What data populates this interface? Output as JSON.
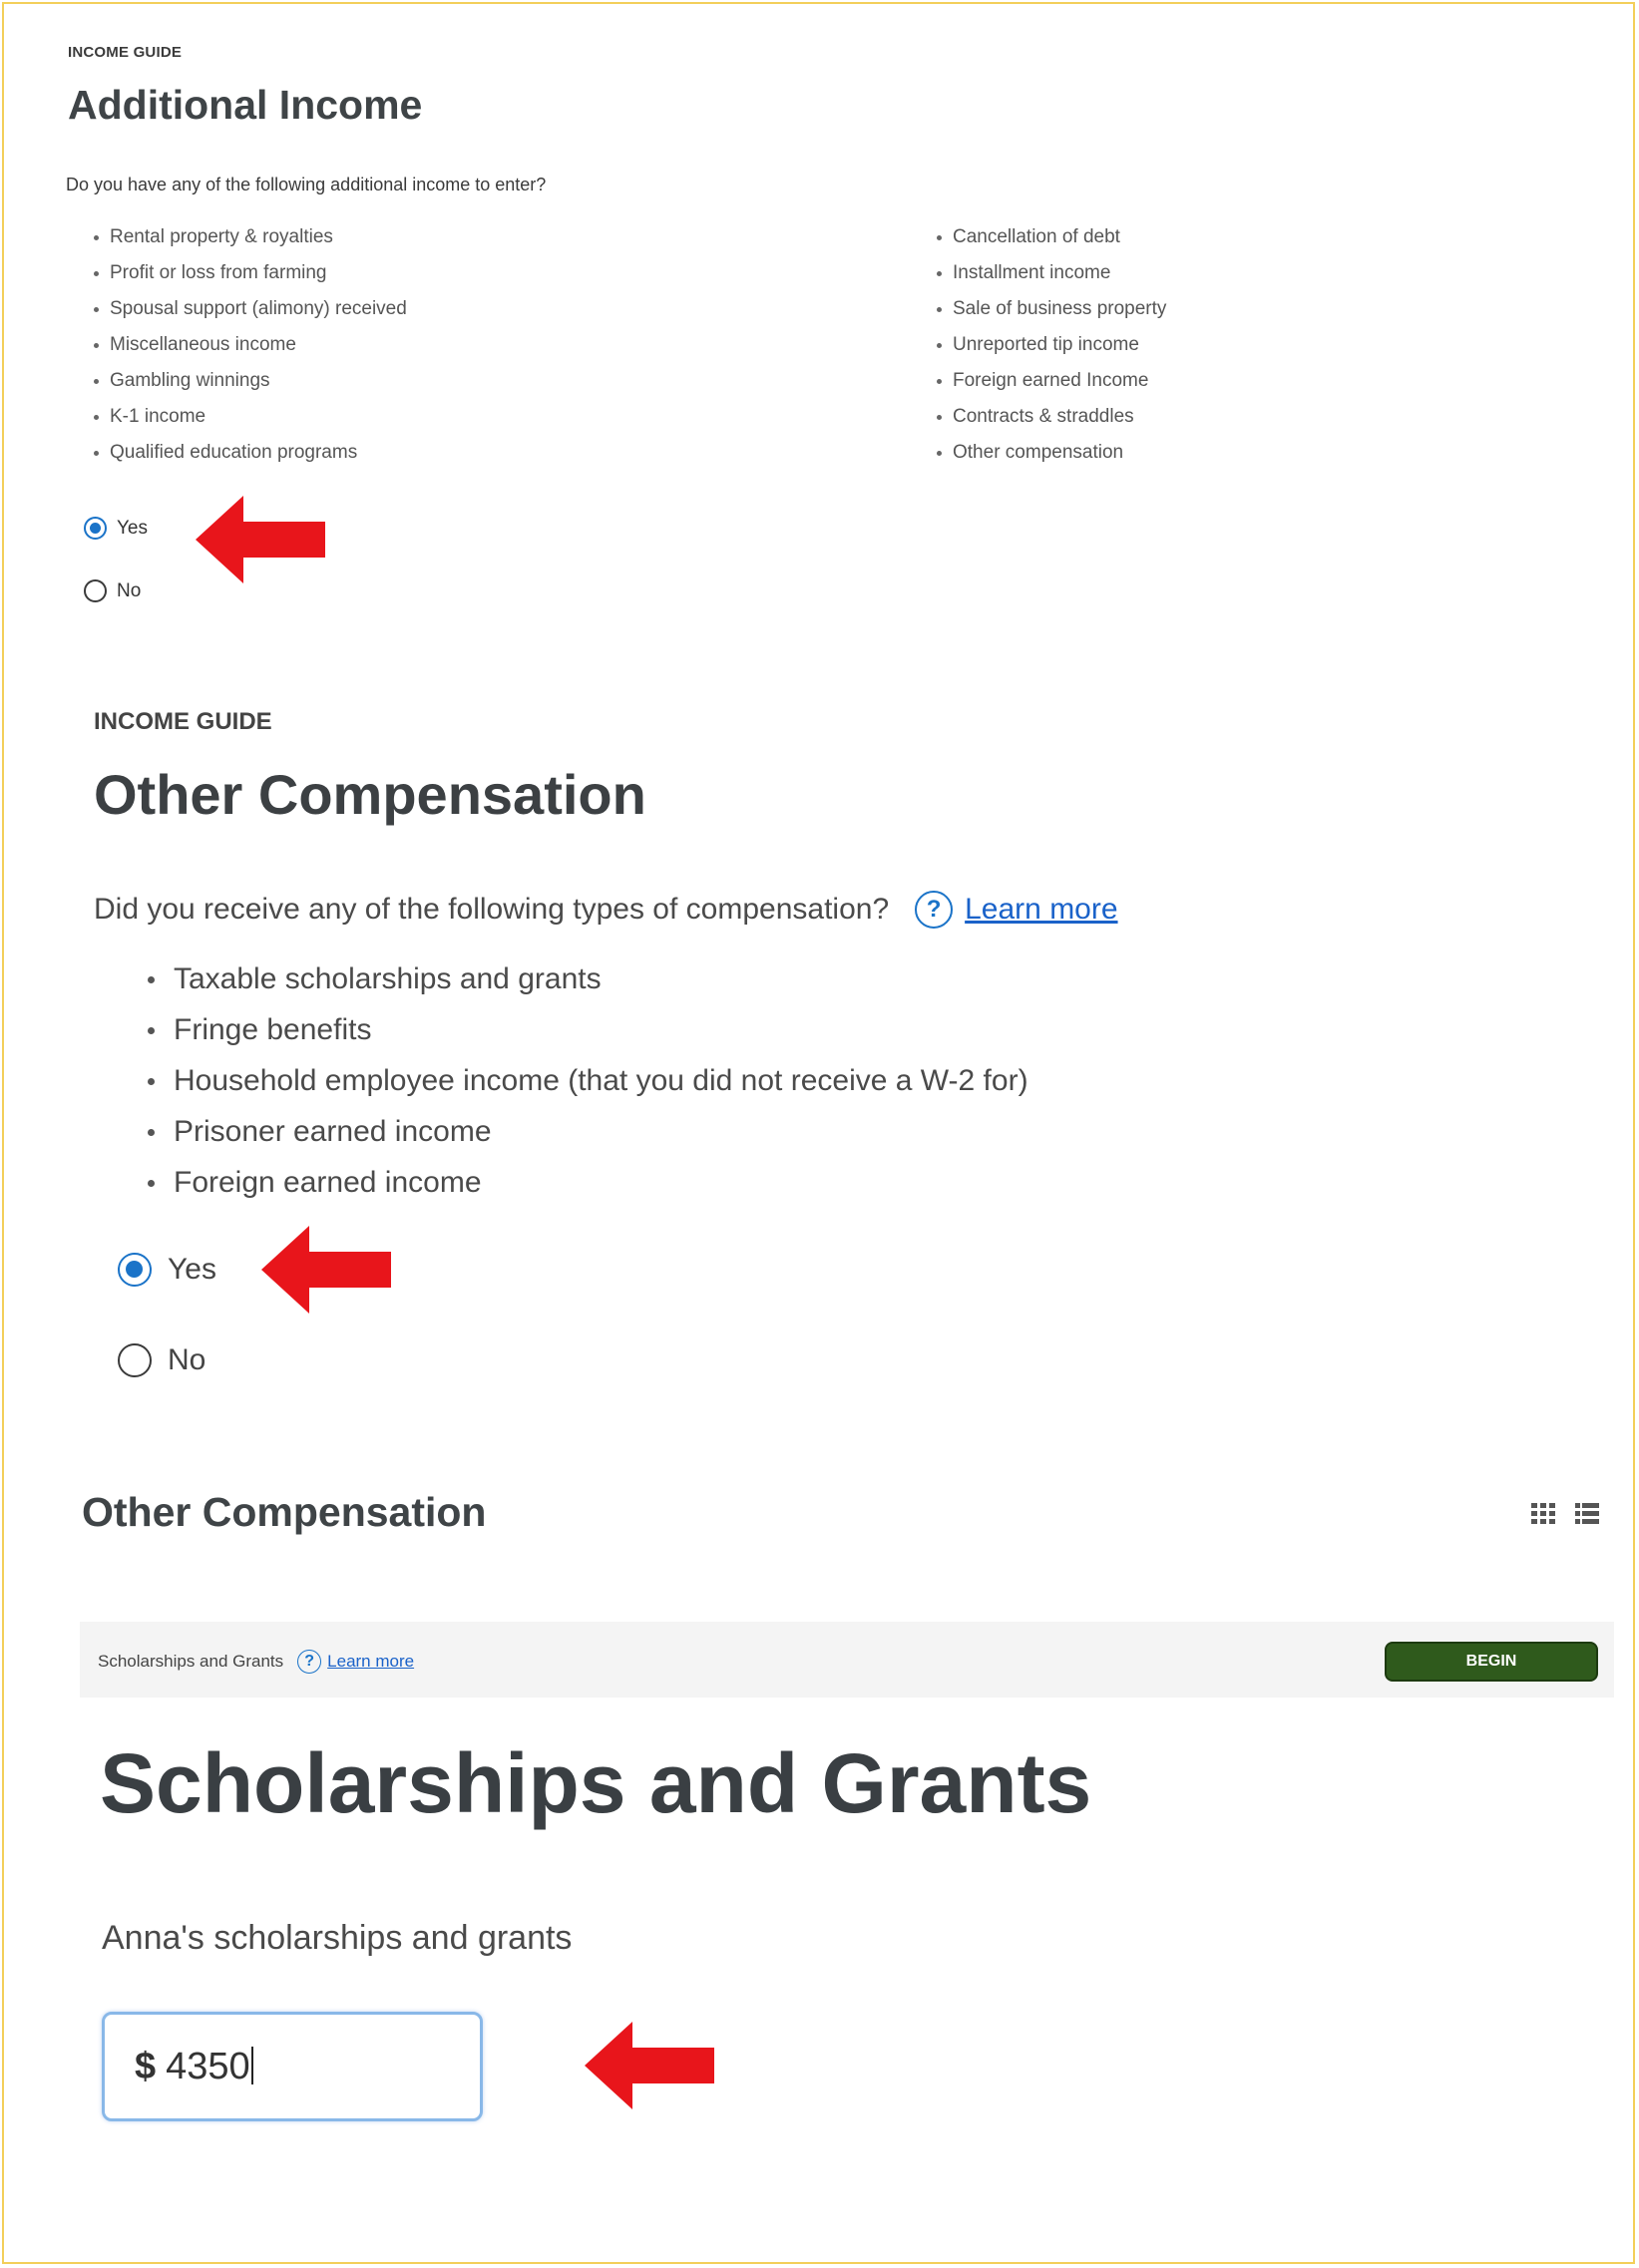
{
  "colors": {
    "accent": "#1a73c8",
    "arrow": "#e8151b",
    "begin_button": "#2f5a1c",
    "frame": "#f3cf5a"
  },
  "section1": {
    "eyebrow": "INCOME GUIDE",
    "title": "Additional Income",
    "question": "Do you have any of the following additional income to enter?",
    "items_left": [
      "Rental property & royalties",
      "Profit or loss from farming",
      "Spousal support (alimony) received",
      "Miscellaneous income",
      "Gambling winnings",
      "K-1 income",
      "Qualified education programs"
    ],
    "items_right": [
      "Cancellation of debt",
      "Installment income",
      "Sale of business property",
      "Unreported tip income",
      "Foreign earned Income",
      "Contracts & straddles",
      "Other compensation"
    ],
    "options": {
      "yes": "Yes",
      "no": "No",
      "selected": "Yes"
    }
  },
  "section2": {
    "eyebrow": "INCOME GUIDE",
    "title": "Other Compensation",
    "question": "Did you receive any of the following types of compensation?",
    "help_icon": "?",
    "learn_more": "Learn more",
    "items": [
      "Taxable scholarships and grants",
      "Fringe benefits",
      "Household employee income (that you did not receive a W-2 for)",
      "Prisoner earned income",
      "Foreign earned income"
    ],
    "options": {
      "yes": "Yes",
      "no": "No",
      "selected": "Yes"
    }
  },
  "section3": {
    "title": "Other Compensation",
    "view_icons": [
      "grid-view-icon",
      "list-view-icon"
    ],
    "bar_label": "Scholarships and Grants",
    "help_icon": "?",
    "learn_more": "Learn more",
    "begin_label": "BEGIN",
    "heading": "Scholarships and Grants",
    "field_label": "Anna's scholarships and grants",
    "currency_symbol": "$",
    "amount_value": "4350"
  }
}
